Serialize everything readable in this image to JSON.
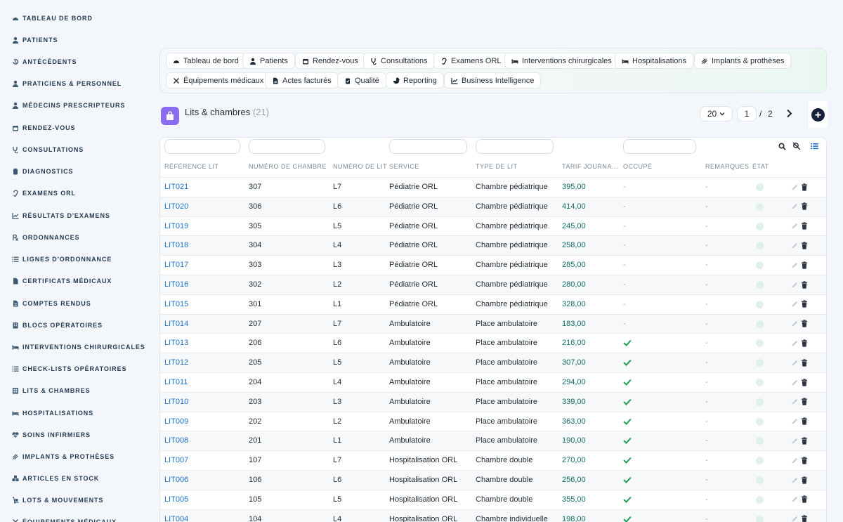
{
  "sidebar": {
    "items": [
      {
        "label": "TABLEAU DE BORD",
        "icon": "dashboard-icon"
      },
      {
        "label": "PATIENTS",
        "icon": "user-icon"
      },
      {
        "label": "ANTÉCÉDENTS",
        "icon": "history-icon"
      },
      {
        "label": "PRATICIENS & PERSONNEL",
        "icon": "staff-icon"
      },
      {
        "label": "MÉDECINS PRESCRIPTEURS",
        "icon": "doctor-icon"
      },
      {
        "label": "RENDEZ-VOUS",
        "icon": "calendar-icon"
      },
      {
        "label": "CONSULTATIONS",
        "icon": "stethoscope-icon"
      },
      {
        "label": "DIAGNOSTICS",
        "icon": "clipboard-icon"
      },
      {
        "label": "EXAMENS ORL",
        "icon": "ear-icon"
      },
      {
        "label": "RÉSULTATS D'EXAMENS",
        "icon": "chart-line-icon"
      },
      {
        "label": "ORDONNANCES",
        "icon": "prescription-icon"
      },
      {
        "label": "LIGNES D'ORDONNANCE",
        "icon": "list-icon"
      },
      {
        "label": "CERTIFICATS MÉDICAUX",
        "icon": "file-icon"
      },
      {
        "label": "COMPTES RENDUS",
        "icon": "file-text-icon"
      },
      {
        "label": "BLOCS OPÉRATOIRES",
        "icon": "building-icon"
      },
      {
        "label": "INTERVENTIONS CHIRURGICALES",
        "icon": "bed-icon"
      },
      {
        "label": "CHECK-LISTS OPÉRATOIRES",
        "icon": "checklist-icon"
      },
      {
        "label": "LITS & CHAMBRES",
        "icon": "hospital-icon"
      },
      {
        "label": "HOSPITALISATIONS",
        "icon": "bed-icon"
      },
      {
        "label": "SOINS INFIRMIERS",
        "icon": "heart-pulse-icon"
      },
      {
        "label": "IMPLANTS & PROTHÈSES",
        "icon": "implant-icon"
      },
      {
        "label": "ARTICLES EN STOCK",
        "icon": "boxes-icon"
      },
      {
        "label": "LOTS & MOUVEMENTS",
        "icon": "dolly-icon"
      },
      {
        "label": "ÉQUIPEMENTS MÉDICAUX",
        "icon": "tools-icon"
      }
    ]
  },
  "modules": [
    {
      "label": "Tableau de bord",
      "icon": "gauge-icon"
    },
    {
      "label": "Patients",
      "icon": "user-icon"
    },
    {
      "label": "Rendez-vous",
      "icon": "calendar-icon"
    },
    {
      "label": "Consultations",
      "icon": "stethoscope-icon"
    },
    {
      "label": "Examens ORL",
      "icon": "ear-icon"
    },
    {
      "label": "Interventions chirurgicales",
      "icon": "bed-icon"
    },
    {
      "label": "Hospitalisations",
      "icon": "bed-icon"
    },
    {
      "label": "Implants & prothèses",
      "icon": "implant-icon"
    },
    {
      "label": "Équipements médicaux",
      "icon": "tools-icon"
    },
    {
      "label": "Actes facturés",
      "icon": "invoice-icon"
    },
    {
      "label": "Qualité",
      "icon": "clipboard-check-icon"
    },
    {
      "label": "Reporting",
      "icon": "pie-icon"
    },
    {
      "label": "Business Intelligence",
      "icon": "chart-line-icon"
    }
  ],
  "page": {
    "title": "Lits & chambres",
    "count": "(21)",
    "page_size": "20",
    "current_page": "1",
    "separator": "/",
    "total_pages": "2"
  },
  "table": {
    "columns": [
      "RÉFÉRENCE LIT",
      "NUMÉRO DE CHAMBRE",
      "NUMÉRO DE LIT",
      "SERVICE",
      "TYPE DE LIT",
      "TARIF JOURNA...",
      "OCCUPÉ",
      "REMARQUES",
      "ÉTAT"
    ],
    "rows": [
      {
        "ref": "LIT021",
        "chambre": "307",
        "lit": "L7",
        "service": "Pédiatrie ORL",
        "type": "Chambre pédiatrique",
        "tarif": "395,00",
        "occupe": false,
        "remarques": "-"
      },
      {
        "ref": "LIT020",
        "chambre": "306",
        "lit": "L6",
        "service": "Pédiatrie ORL",
        "type": "Chambre pédiatrique",
        "tarif": "414,00",
        "occupe": false,
        "remarques": "-"
      },
      {
        "ref": "LIT019",
        "chambre": "305",
        "lit": "L5",
        "service": "Pédiatrie ORL",
        "type": "Chambre pédiatrique",
        "tarif": "245,00",
        "occupe": false,
        "remarques": "-"
      },
      {
        "ref": "LIT018",
        "chambre": "304",
        "lit": "L4",
        "service": "Pédiatrie ORL",
        "type": "Chambre pédiatrique",
        "tarif": "258,00",
        "occupe": false,
        "remarques": "-"
      },
      {
        "ref": "LIT017",
        "chambre": "303",
        "lit": "L3",
        "service": "Pédiatrie ORL",
        "type": "Chambre pédiatrique",
        "tarif": "285,00",
        "occupe": false,
        "remarques": "-"
      },
      {
        "ref": "LIT016",
        "chambre": "302",
        "lit": "L2",
        "service": "Pédiatrie ORL",
        "type": "Chambre pédiatrique",
        "tarif": "280,00",
        "occupe": false,
        "remarques": "-"
      },
      {
        "ref": "LIT015",
        "chambre": "301",
        "lit": "L1",
        "service": "Pédiatrie ORL",
        "type": "Chambre pédiatrique",
        "tarif": "328,00",
        "occupe": false,
        "remarques": "-"
      },
      {
        "ref": "LIT014",
        "chambre": "207",
        "lit": "L7",
        "service": "Ambulatoire",
        "type": "Place ambulatoire",
        "tarif": "183,00",
        "occupe": false,
        "remarques": "-"
      },
      {
        "ref": "LIT013",
        "chambre": "206",
        "lit": "L6",
        "service": "Ambulatoire",
        "type": "Place ambulatoire",
        "tarif": "216,00",
        "occupe": true,
        "remarques": "-"
      },
      {
        "ref": "LIT012",
        "chambre": "205",
        "lit": "L5",
        "service": "Ambulatoire",
        "type": "Place ambulatoire",
        "tarif": "307,00",
        "occupe": true,
        "remarques": "-"
      },
      {
        "ref": "LIT011",
        "chambre": "204",
        "lit": "L4",
        "service": "Ambulatoire",
        "type": "Place ambulatoire",
        "tarif": "294,00",
        "occupe": true,
        "remarques": "-"
      },
      {
        "ref": "LIT010",
        "chambre": "203",
        "lit": "L3",
        "service": "Ambulatoire",
        "type": "Place ambulatoire",
        "tarif": "339,00",
        "occupe": true,
        "remarques": "-"
      },
      {
        "ref": "LIT009",
        "chambre": "202",
        "lit": "L2",
        "service": "Ambulatoire",
        "type": "Place ambulatoire",
        "tarif": "363,00",
        "occupe": true,
        "remarques": "-"
      },
      {
        "ref": "LIT008",
        "chambre": "201",
        "lit": "L1",
        "service": "Ambulatoire",
        "type": "Place ambulatoire",
        "tarif": "190,00",
        "occupe": true,
        "remarques": "-"
      },
      {
        "ref": "LIT007",
        "chambre": "107",
        "lit": "L7",
        "service": "Hospitalisation ORL",
        "type": "Chambre double",
        "tarif": "270,00",
        "occupe": true,
        "remarques": "-"
      },
      {
        "ref": "LIT006",
        "chambre": "106",
        "lit": "L6",
        "service": "Hospitalisation ORL",
        "type": "Chambre double",
        "tarif": "256,00",
        "occupe": true,
        "remarques": "-"
      },
      {
        "ref": "LIT005",
        "chambre": "105",
        "lit": "L5",
        "service": "Hospitalisation ORL",
        "type": "Chambre double",
        "tarif": "355,00",
        "occupe": true,
        "remarques": "-"
      },
      {
        "ref": "LIT004",
        "chambre": "104",
        "lit": "L4",
        "service": "Hospitalisation ORL",
        "type": "Chambre individuelle",
        "tarif": "198,00",
        "occupe": true,
        "remarques": "-"
      }
    ]
  },
  "colors": {
    "link": "#1a73c7",
    "price": "#0f6b62",
    "check": "#1f9d55",
    "title_icon_bg": "#8b6cf0",
    "add_button": "#16213b"
  }
}
